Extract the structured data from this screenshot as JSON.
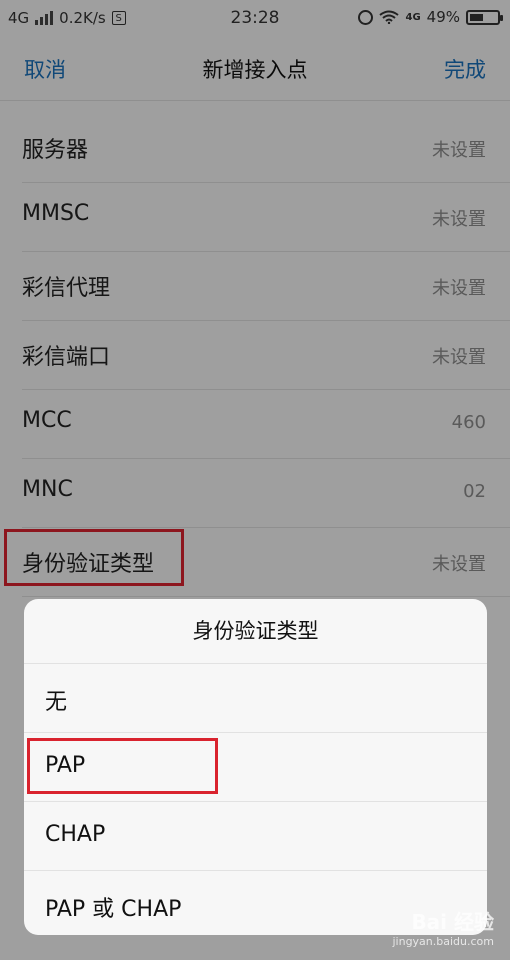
{
  "status_bar": {
    "network": "4G",
    "speed": "0.2K/s",
    "s_icon": "S",
    "time": "23:28",
    "lte": "4G",
    "battery": "49%",
    "battery_level": 0.49
  },
  "nav": {
    "cancel": "取消",
    "title": "新增接入点",
    "done": "完成"
  },
  "settings": [
    {
      "label": "服务器",
      "value": "未设置"
    },
    {
      "label": "MMSC",
      "value": "未设置"
    },
    {
      "label": "彩信代理",
      "value": "未设置"
    },
    {
      "label": "彩信端口",
      "value": "未设置"
    },
    {
      "label": "MCC",
      "value": "460"
    },
    {
      "label": "MNC",
      "value": "02"
    },
    {
      "label": "身份验证类型",
      "value": "未设置"
    }
  ],
  "sheet": {
    "title": "身份验证类型",
    "options": [
      "无",
      "PAP",
      "CHAP",
      "PAP 或 CHAP"
    ]
  },
  "watermark": {
    "brand": "Bai 经验",
    "url": "jingyan.baidu.com"
  },
  "colors": {
    "accent": "#1a6fb8",
    "highlight": "#d9232e"
  }
}
